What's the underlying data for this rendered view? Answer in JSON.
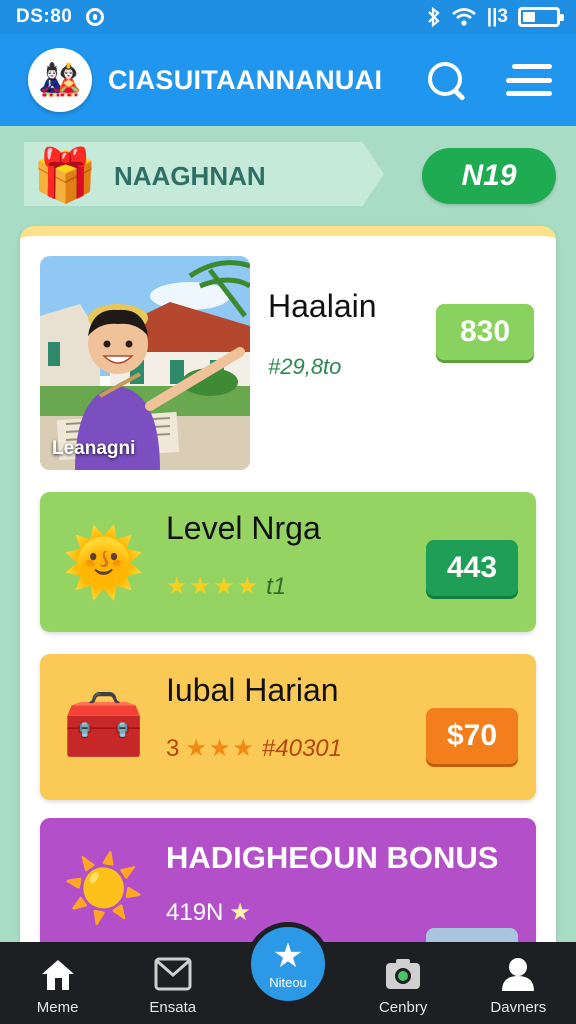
{
  "status_bar": {
    "time": "DS:80",
    "network_label": "||3"
  },
  "app_bar": {
    "title": "CIASUITAANNANUAI"
  },
  "banner": {
    "label": "NAAGHNAN",
    "pill_value": "N19"
  },
  "hero": {
    "image_caption": "Leanagni",
    "title": "Haalain",
    "subtitle": "#29,8to",
    "button_value": "830"
  },
  "rows": [
    {
      "title": "Level Nrga",
      "stars": "★★★★",
      "lead": "",
      "meta": "t1",
      "button_value": "443",
      "icon": "sun-leaf-icon"
    },
    {
      "title": "Iubal Harian",
      "stars": "★★★",
      "lead": "3",
      "meta": "#40301",
      "button_value": "$70",
      "icon": "treasure-chest-icon"
    },
    {
      "title": "HADIGHEOUN BONUS",
      "stars": "★",
      "lead": "419N",
      "meta": "",
      "button_value": "",
      "icon": "sun-icon"
    }
  ],
  "bottom_nav": [
    {
      "label": "Meme",
      "icon": "home-icon"
    },
    {
      "label": "Ensata",
      "icon": "mail-icon"
    },
    {
      "label": "Niteou",
      "icon": "star-icon"
    },
    {
      "label": "Cenbry",
      "icon": "camera-icon"
    },
    {
      "label": "Davners",
      "icon": "person-icon"
    }
  ],
  "colors": {
    "app_bar": "#2196ef",
    "background": "#a9dcc4",
    "green_card": "#95d462",
    "yellow_card": "#fbc955",
    "purple_card": "#b24fc9"
  }
}
